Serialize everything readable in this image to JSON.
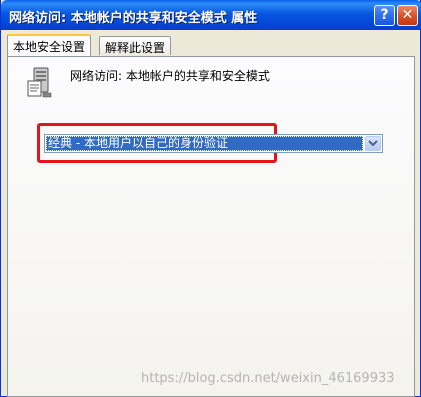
{
  "window": {
    "title": "网络访问: 本地帐户的共享和安全模式 属性",
    "help_label": "?",
    "close_label": "✕"
  },
  "tabs": [
    {
      "label": "本地安全设置",
      "active": true
    },
    {
      "label": "解释此设置",
      "active": false
    }
  ],
  "policy": {
    "icon": "policy-server-icon",
    "title": "网络访问: 本地帐户的共享和安全模式"
  },
  "dropdown": {
    "selected": "经典 - 本地用户以自己的身份验证"
  },
  "watermark": "https://blog.csdn.net/weixin_46169933",
  "colors": {
    "titlebar": "#0a5ee9",
    "selection": "#316ac5",
    "highlight_box": "#e0161b",
    "active_tab_accent": "#ffc83c"
  }
}
